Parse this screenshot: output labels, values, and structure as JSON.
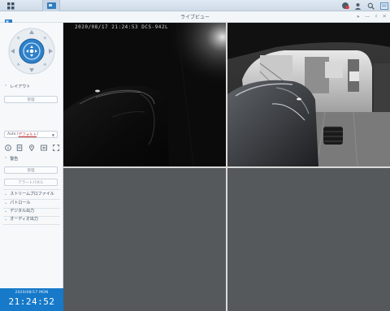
{
  "window": {
    "title": "ライブビュー"
  },
  "sidebar": {
    "layout": {
      "header": "レイアウト",
      "manage_button": "管理",
      "select_value_prefix": "Auto (",
      "select_value_highlight": "デフォルト",
      "select_value_suffix": ")"
    },
    "alerts": {
      "header": "警告",
      "manage_button": "管理",
      "alert_panel_button": "アラートパネル"
    },
    "collapsed_sections": [
      "ストリームプロファイル",
      "パトロール",
      "デジタル出力",
      "オーディオ出力"
    ]
  },
  "clock": {
    "date": "2020/08/17  MON",
    "time": "21:24:52"
  },
  "camera1": {
    "osd": "2020/08/17 21:24:53 DCS-942L"
  },
  "colors": {
    "accent": "#1679c9",
    "taskbar": "#cfdbe7"
  },
  "icons": [
    "grid-icon",
    "surveillance-app-icon",
    "notification-icon",
    "user-icon",
    "search-icon",
    "widgets-icon"
  ]
}
